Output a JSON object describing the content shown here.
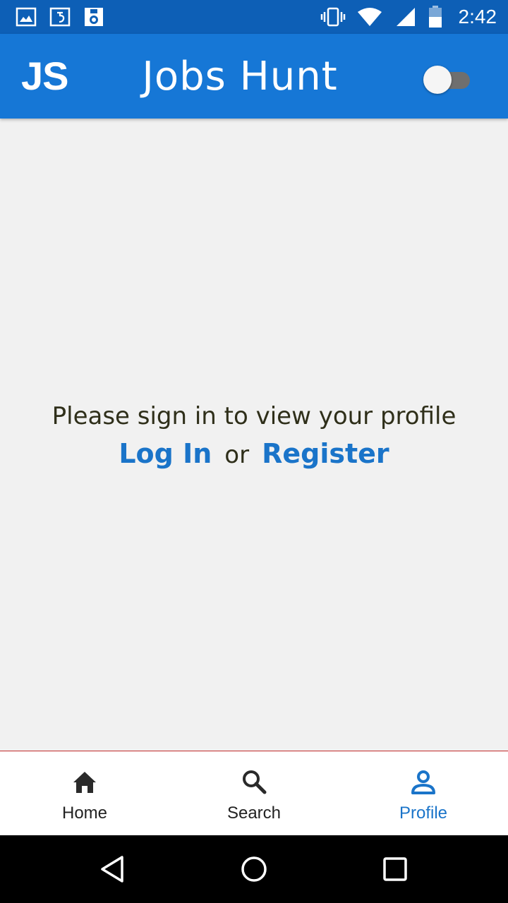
{
  "status_bar": {
    "time": "2:42",
    "left_icons": [
      "image-notification-icon",
      "text-notification-icon",
      "app-notification-icon"
    ],
    "right_icons": [
      "vibrate-icon",
      "wifi-icon",
      "cell-signal-icon",
      "battery-icon"
    ]
  },
  "app_bar": {
    "logo": "JS",
    "title": "Jobs Hunt",
    "theme_toggle_on": false
  },
  "content": {
    "message": "Please sign in to view your profile",
    "login_label": "Log In",
    "or_label": "or",
    "register_label": "Register"
  },
  "bottom_nav": {
    "items": [
      {
        "label": "Home",
        "icon": "home-icon",
        "active": false
      },
      {
        "label": "Search",
        "icon": "search-icon",
        "active": false
      },
      {
        "label": "Profile",
        "icon": "profile-icon",
        "active": true
      }
    ]
  },
  "colors": {
    "status_bar": "#0d5fb6",
    "app_bar": "#1677d6",
    "accent": "#1a74c9",
    "background": "#f1f1f1",
    "nav_divider": "#c22a2a"
  }
}
